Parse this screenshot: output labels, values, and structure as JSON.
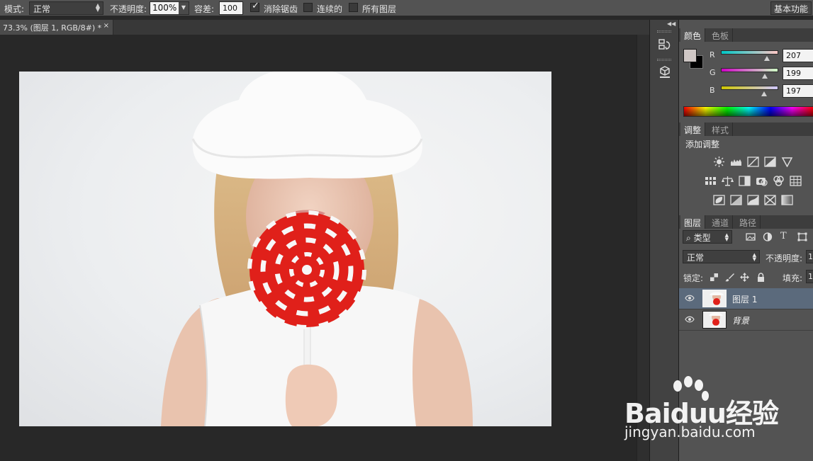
{
  "options_bar": {
    "mode_label": "模式:",
    "mode_value": "正常",
    "opacity_label": "不透明度:",
    "opacity_value": "100%",
    "tolerance_label": "容差:",
    "tolerance_value": "100",
    "antialias_label": "消除锯齿",
    "antialias_checked": true,
    "contiguous_label": "连续的",
    "contiguous_checked": false,
    "all_layers_label": "所有图层",
    "all_layers_checked": false,
    "workspace_button": "基本功能"
  },
  "document_tab": {
    "title": "73.3% (图层 1, RGB/8#) *",
    "close": "×"
  },
  "color_panel": {
    "tabs": [
      "颜色",
      "色板"
    ],
    "active_tab": 0,
    "foreground_color": "#cfc7c5",
    "background_color": "#000000",
    "channels": [
      {
        "label": "R",
        "value": "207",
        "fraction": 0.81
      },
      {
        "label": "G",
        "value": "199",
        "fraction": 0.78
      },
      {
        "label": "B",
        "value": "197",
        "fraction": 0.77
      }
    ]
  },
  "adjustments_panel": {
    "tabs": [
      "调整",
      "样式"
    ],
    "active_tab": 0,
    "heading": "添加调整",
    "icons": [
      "brightness-contrast-icon",
      "levels-icon",
      "curves-icon",
      "exposure-icon",
      "vibrance-icon",
      "hue-saturation-icon",
      "color-balance-icon",
      "black-white-icon",
      "photo-filter-icon",
      "channel-mixer-icon",
      "color-lookup-icon",
      "invert-icon",
      "posterize-icon",
      "threshold-icon",
      "selective-color-icon",
      "gradient-map-icon"
    ]
  },
  "layers_panel": {
    "tabs": [
      "图层",
      "通道",
      "路径"
    ],
    "active_tab": 0,
    "filter_label": "类型",
    "blend_mode": "正常",
    "opacity_label": "不透明度:",
    "opacity_value": "1",
    "lock_label": "锁定:",
    "fill_label": "填充:",
    "fill_value": "1",
    "layers": [
      {
        "name": "图层 1",
        "selected": true,
        "visible": true
      },
      {
        "name": "背景",
        "selected": false,
        "visible": true
      }
    ]
  },
  "watermark": {
    "line1": "Baiduu经验",
    "line2": "jingyan.baidu.com"
  }
}
